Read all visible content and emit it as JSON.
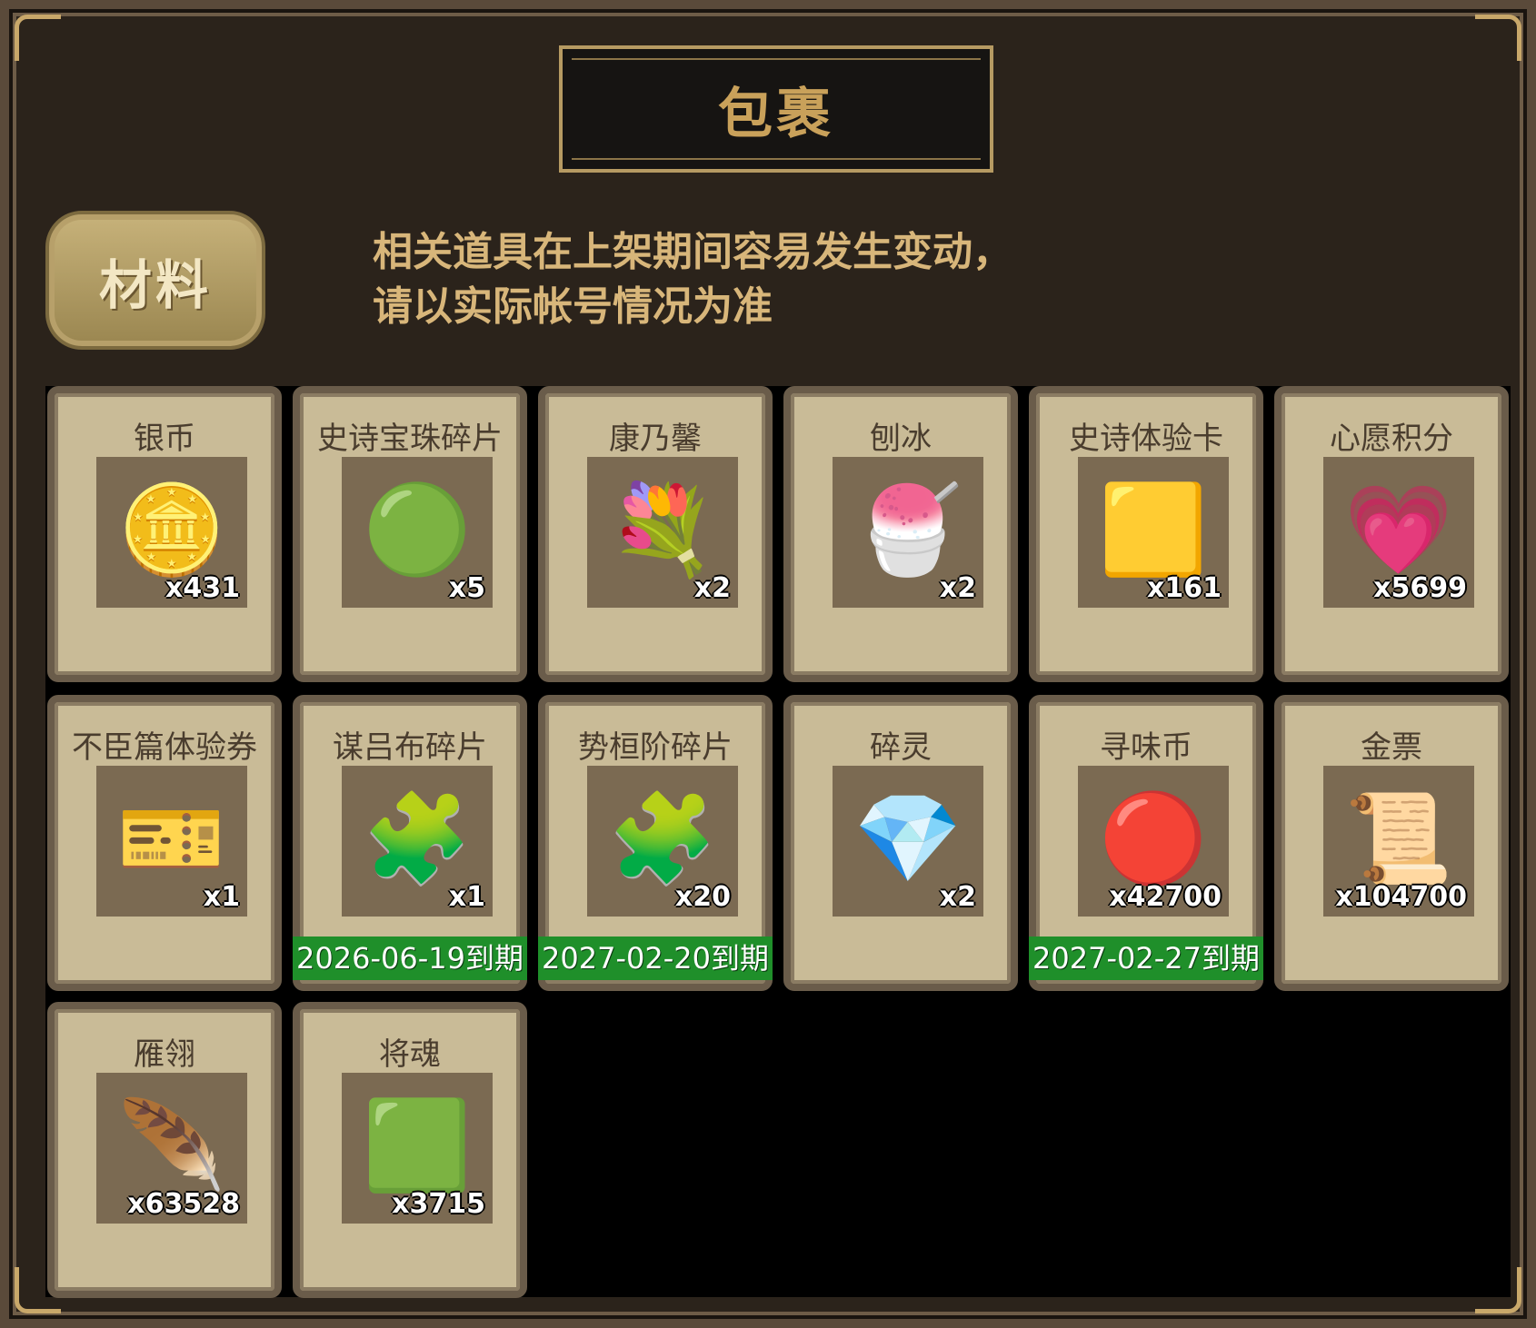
{
  "title": "包裹",
  "tab": "材料",
  "notice": [
    "相关道具在上架期间容易发生变动，",
    "请以实际帐号情况为准"
  ],
  "items": [
    {
      "name": "银币",
      "qty": "x431",
      "icon": "silver-coin-icon",
      "glyph": "🪙",
      "color": "#9aa3a8"
    },
    {
      "name": "史诗宝珠碎片",
      "qty": "x5",
      "icon": "green-shard-icon",
      "glyph": "🟢",
      "color": "#4fb34a"
    },
    {
      "name": "康乃馨",
      "qty": "x2",
      "icon": "carnation-flower-icon",
      "glyph": "💐",
      "color": "#e6899b"
    },
    {
      "name": "刨冰",
      "qty": "x2",
      "icon": "shaved-ice-icon",
      "glyph": "🍧",
      "color": "#f2d2d2"
    },
    {
      "name": "史诗体验卡",
      "qty": "x161",
      "icon": "gold-card-icon",
      "glyph": "🟨",
      "color": "#e4c54b"
    },
    {
      "name": "心愿积分",
      "qty": "x5699",
      "icon": "heart-coin-icon",
      "glyph": "💗",
      "color": "#a78a62"
    },
    {
      "name": "不臣篇体验券",
      "qty": "x1",
      "icon": "voucher-ticket-icon",
      "glyph": "🎫",
      "color": "#d48840"
    },
    {
      "name": "谋吕布碎片",
      "qty": "x1",
      "icon": "puzzle-piece-icon",
      "glyph": "🧩",
      "color": "#d7a851",
      "expire": "2026-06-19到期"
    },
    {
      "name": "势桓阶碎片",
      "qty": "x20",
      "icon": "puzzle-piece-icon",
      "glyph": "🧩",
      "color": "#d7a851",
      "expire": "2027-02-20到期"
    },
    {
      "name": "碎灵",
      "qty": "x2",
      "icon": "blue-crystal-icon",
      "glyph": "💎",
      "color": "#5c8ee0"
    },
    {
      "name": "寻味币",
      "qty": "x42700",
      "icon": "taste-coin-icon",
      "glyph": "🔴",
      "color": "#c94a2c",
      "expire": "2027-02-27到期"
    },
    {
      "name": "金票",
      "qty": "x104700",
      "icon": "gold-scroll-icon",
      "glyph": "📜",
      "color": "#e0b439"
    },
    {
      "name": "雁翎",
      "qty": "x63528",
      "icon": "feather-icon",
      "glyph": "🪶",
      "color": "#c9b184"
    },
    {
      "name": "将魂",
      "qty": "x3715",
      "icon": "green-soul-crystal-icon",
      "glyph": "🟩",
      "color": "#55d04a"
    }
  ]
}
